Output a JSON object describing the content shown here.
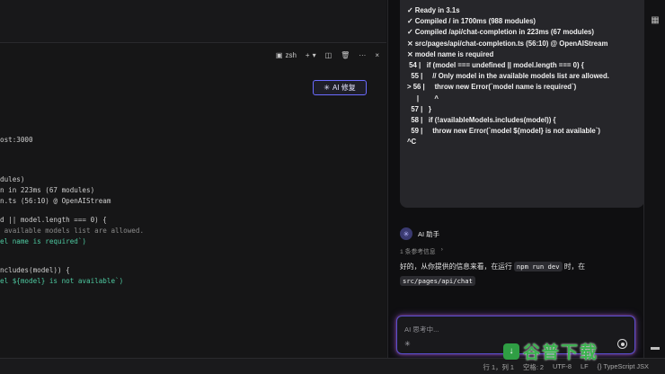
{
  "terminal": {
    "toolbar": {
      "shell_label": "zsh",
      "new_label": "+",
      "split_icon": "split-icon",
      "trash_icon": "trash-icon",
      "more_label": "···",
      "close_label": "×"
    },
    "ai_fix_label": "AI 修复",
    "lines": [
      "ost:3000",
      "dules)",
      "n in 223ms (67 modules)",
      "n.ts (56:10) @ OpenAIStream",
      "d || model.length === 0) {",
      " available models list are allowed.",
      "el name is required`)",
      "ncludes(model)) {",
      "el ${model} is not available`)"
    ]
  },
  "chat": {
    "log_lines": [
      "✓ Ready in 3.1s",
      "✓ Compiled / in 1700ms (988 modules)",
      "✓ Compiled /api/chat-completion in 223ms (67 modules)",
      "⨯ src/pages/api/chat-completion.ts (56:10) @ OpenAIStream",
      "⨯ model name is required",
      " 54 |   if (model === undefined || model.length === 0) {",
      "  55 |     // Only model in the available models list are allowed.",
      "> 56 |     throw new Error(`model name is required`)",
      "     |        ^",
      "  57 |   }",
      "  58 |   if (!availableModels.includes(model)) {",
      "  59 |     throw new Error(`model ${model} is not available`)",
      "^C"
    ],
    "assistant_name": "AI 助手",
    "refs_label": "1 条参考信息",
    "refs_arrow": "›",
    "reply_prefix": "好的，从你提供的信息来看，在运行",
    "reply_code1": "npm run dev",
    "reply_mid": "时，在",
    "reply_code2": "src/pages/api/chat",
    "input_placeholder": "AI 思考中..."
  },
  "statusbar": {
    "position": "行 1，列 1",
    "spaces": "空格: 2",
    "encoding": "UTF-8",
    "eol": "LF",
    "language": "{} TypeScript JSX"
  },
  "watermark": {
    "text": "谷普下载"
  },
  "colors": {
    "accent": "#6b6bff",
    "terminal_green": "#4ec9a0",
    "watermark": "#3bb34f"
  }
}
